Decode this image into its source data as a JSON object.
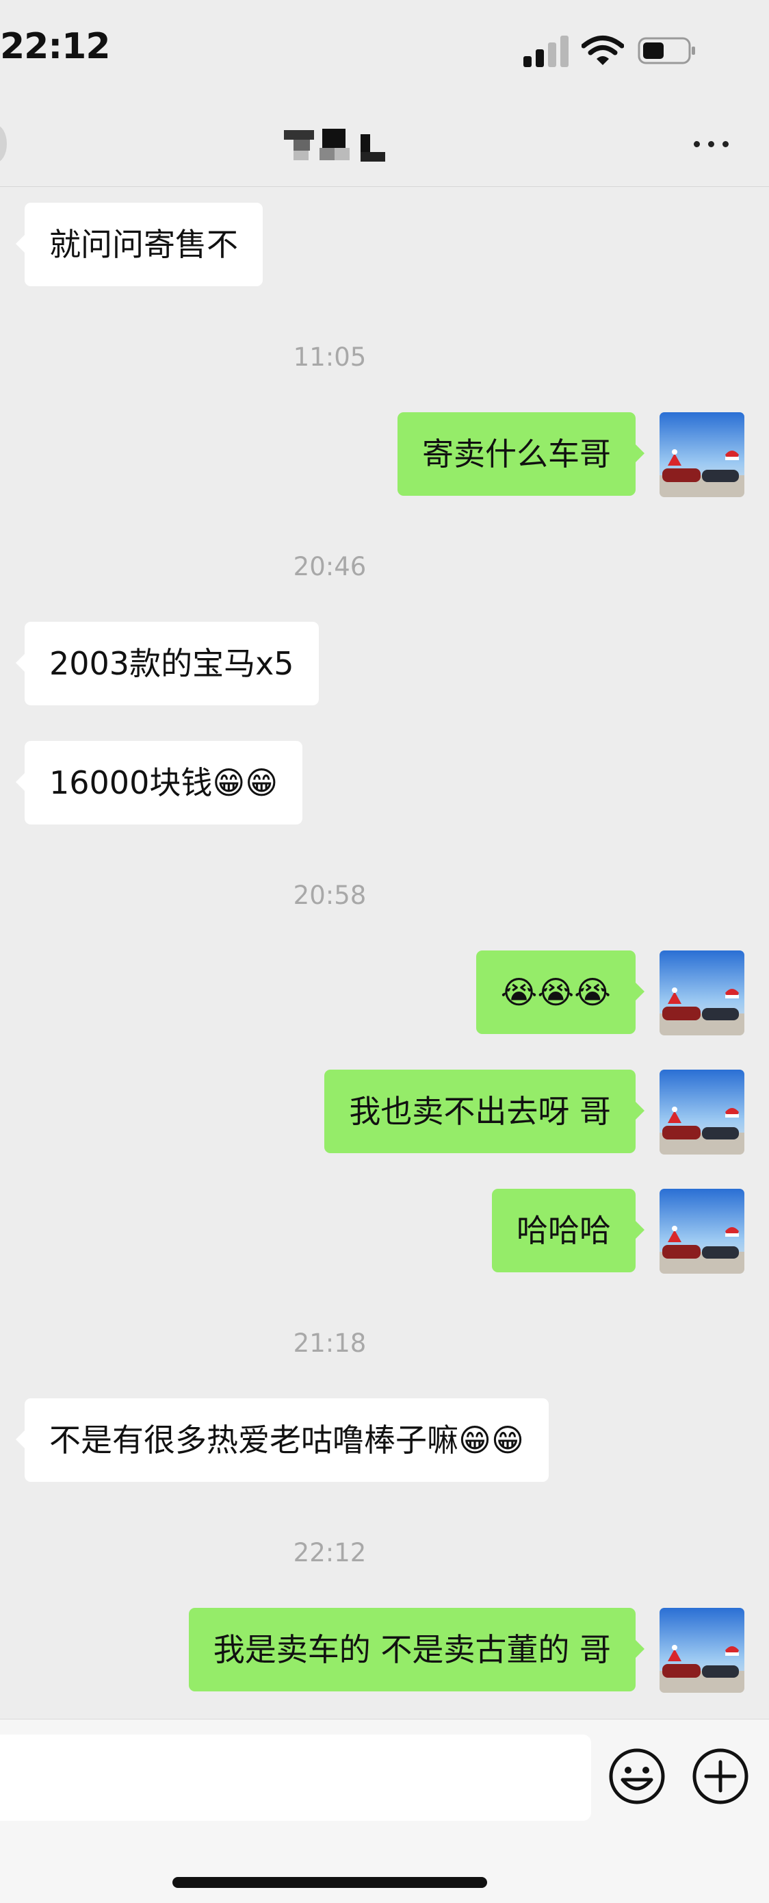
{
  "status_bar": {
    "time": "22:12"
  },
  "chat": {
    "messages": [
      {
        "side": "in",
        "text": "就问问寄售不"
      },
      {
        "timestamp": "11:05"
      },
      {
        "side": "out",
        "text": "寄卖什么车哥"
      },
      {
        "timestamp": "20:46"
      },
      {
        "side": "in",
        "text": "2003款的宝马x5"
      },
      {
        "side": "in",
        "text": "16000块钱😁😁"
      },
      {
        "timestamp": "20:58"
      },
      {
        "side": "out",
        "text": "😭😭😭"
      },
      {
        "side": "out",
        "text": "我也卖不出去呀 哥"
      },
      {
        "side": "out",
        "text": "哈哈哈"
      },
      {
        "timestamp": "21:18"
      },
      {
        "side": "in",
        "text": "不是有很多热爱老咕噜棒子嘛😁😁"
      },
      {
        "timestamp": "22:12"
      },
      {
        "side": "out",
        "text": "我是卖车的 不是卖古董的 哥"
      }
    ]
  },
  "colors": {
    "background": "#ededed",
    "incoming_bubble": "#ffffff",
    "outgoing_bubble": "#95ec69",
    "timestamp": "#a8a8a8"
  },
  "icons": {
    "more": "more-dots-icon",
    "emoji": "smiley-icon",
    "add": "plus-circle-icon"
  }
}
